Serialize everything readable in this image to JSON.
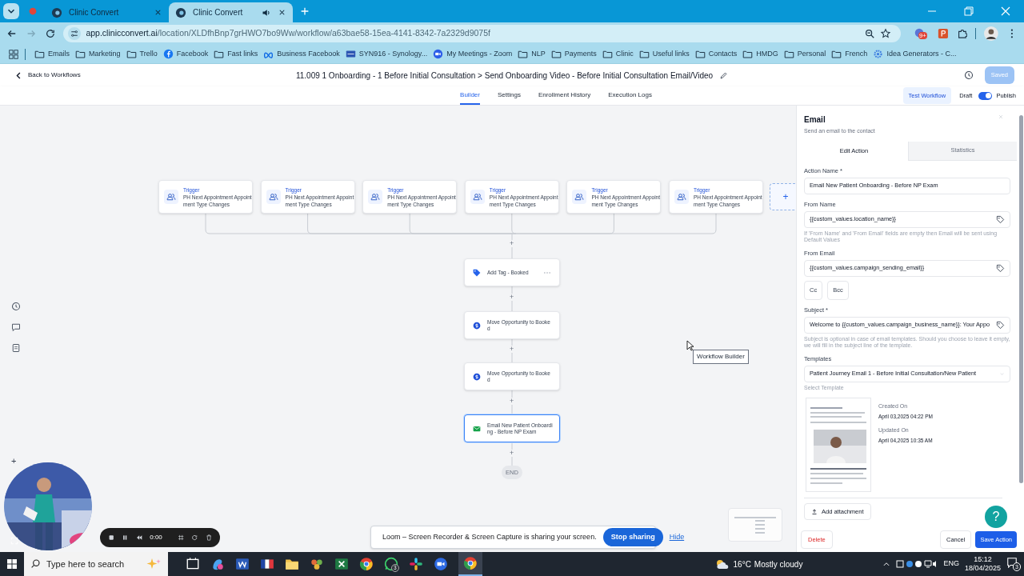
{
  "browser": {
    "tabs": [
      {
        "title": "Clinic Convert",
        "selected": false,
        "audio": false
      },
      {
        "title": "Clinic Convert",
        "selected": true,
        "audio": true
      }
    ],
    "url_domain": "app.clinicconvert.ai",
    "url_path": "/location/XLDfhBnp7grHWO7bo9Ww/workflow/a63bae58-15ea-4141-8342-7a2329d9075f",
    "extension_badge": "9+",
    "bookmarks": [
      {
        "kind": "folder",
        "label": "Emails"
      },
      {
        "kind": "folder",
        "label": "Marketing"
      },
      {
        "kind": "folder",
        "label": "Trello"
      },
      {
        "kind": "facebook",
        "label": "Facebook"
      },
      {
        "kind": "folder",
        "label": "Fast links"
      },
      {
        "kind": "meta",
        "label": "Business Facebook"
      },
      {
        "kind": "nas",
        "label": "SYN916 - Synology..."
      },
      {
        "kind": "video",
        "label": "My Meetings - Zoom"
      },
      {
        "kind": "folder",
        "label": "NLP"
      },
      {
        "kind": "folder",
        "label": "Payments"
      },
      {
        "kind": "folder",
        "label": "Clinic"
      },
      {
        "kind": "folder",
        "label": "Useful links"
      },
      {
        "kind": "folder",
        "label": "Contacts"
      },
      {
        "kind": "folder",
        "label": "HMDG"
      },
      {
        "kind": "folder",
        "label": "Personal"
      },
      {
        "kind": "folder",
        "label": "French"
      },
      {
        "kind": "gear",
        "label": "Idea Generators - C..."
      }
    ]
  },
  "app": {
    "back": "Back to Workflows",
    "title": "11.009 1 Onboarding - 1 Before Initial Consultation > Send Onboarding Video - Before Initial Consultation Email/Video",
    "saved": "Saved",
    "nav": [
      {
        "label": "Builder",
        "selected": true
      },
      {
        "label": "Settings",
        "selected": false
      },
      {
        "label": "Enrollment History",
        "selected": false
      },
      {
        "label": "Execution Logs",
        "selected": false
      }
    ],
    "test_workflow": "Test Workflow",
    "draft": "Draft",
    "publish": "Publish",
    "published": true
  },
  "canvas": {
    "triggers": [
      {
        "label": "Trigger",
        "lines": [
          "PH Next Appointment Appoint",
          "ment Type Changes"
        ]
      },
      {
        "label": "Trigger",
        "lines": [
          "PH Next Appointment Appoint",
          "ment Type Changes"
        ]
      },
      {
        "label": "Trigger",
        "lines": [
          "PH Next Appointment Appoint",
          "ment Type Changes"
        ]
      },
      {
        "label": "Trigger",
        "lines": [
          "PH Next Appointment Appoint",
          "ment Type Changes"
        ]
      },
      {
        "label": "Trigger",
        "lines": [
          "PH Next Appointment Appoint",
          "ment Type Changes"
        ]
      },
      {
        "label": "Trigger",
        "lines": [
          "PH Next Appointment Appoint",
          "ment Type Changes"
        ]
      }
    ],
    "add_trigger": "+",
    "plus": "+",
    "actions": [
      {
        "kind": "tag",
        "lines": [
          "Add Tag - Booked"
        ],
        "selected": false
      },
      {
        "kind": "opportunity",
        "lines": [
          "Move Opportunity to Booke",
          "d"
        ],
        "selected": false
      },
      {
        "kind": "opportunity",
        "lines": [
          "Move Opportunity to Booke",
          "d"
        ],
        "selected": false
      },
      {
        "kind": "email",
        "lines": [
          "Email New Patient Onboardi",
          "ng - Before NP Exam"
        ],
        "selected": true
      }
    ],
    "end": "END",
    "zoom_in": "+",
    "tooltip": "Workflow Builder"
  },
  "panel": {
    "title": "Email",
    "subtitle": "Send an email to the contact",
    "tabs": [
      {
        "label": "Edit Action",
        "selected": true
      },
      {
        "label": "Statistics",
        "selected": false
      }
    ],
    "items": [
      {
        "kind": "input",
        "label": "Action Name *",
        "value": "Email New Patient Onboarding - Before NP Exam",
        "tag_button": false
      },
      {
        "kind": "input",
        "label": "From Name",
        "value": "{{custom_values.location_name}}",
        "tag_button": true,
        "hint": "If 'From Name' and 'From Email' fields are empty then Email will be sent using Default Values"
      },
      {
        "kind": "input",
        "label": "From Email",
        "value": "{{custom_values.campaign_sending_email}}",
        "tag_button": true
      },
      {
        "kind": "buttons",
        "buttons": [
          "Cc",
          "Bcc"
        ]
      },
      {
        "kind": "input",
        "label": "Subject *",
        "value": "Welcome to {{custom_values.campaign_business_name}}: Your Appo",
        "tag_button": true,
        "hint": "Subject is optional in case of email templates. Should you choose to leave it empty, we will fill in the subject line of the template."
      },
      {
        "kind": "select",
        "label": "Templates",
        "value": "Patient Journey Email 1 - Before Initial Consultation/New Patient",
        "hint": "Select Template"
      }
    ],
    "template": {
      "created_label": "Created On",
      "created": "April 03,2025 04:22 PM",
      "updated_label": "Updated On",
      "updated": "April 04,2025 10:35 AM"
    },
    "add_attachment": "Add attachment",
    "delete": "Delete",
    "cancel": "Cancel",
    "save": "Save Action"
  },
  "loom": {
    "timer": "0:00",
    "message": "Loom – Screen Recorder & Screen Capture is sharing your screen.",
    "stop": "Stop sharing",
    "hide": "Hide"
  },
  "help": "?",
  "taskbar": {
    "search_placeholder": "Type here to search",
    "chat_badge": "3",
    "temperature": "16°C",
    "weather": "Mostly cloudy",
    "language": "ENG",
    "time": "15:12",
    "date": "18/04/2025",
    "notifications": "3"
  }
}
